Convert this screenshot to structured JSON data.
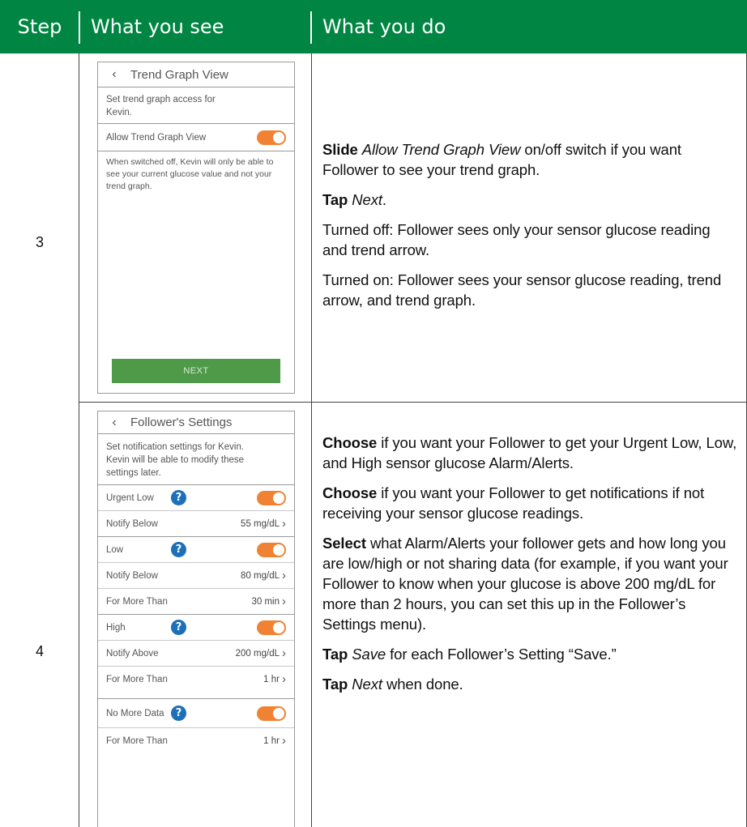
{
  "header": {
    "step": "Step",
    "what_you_see": "What you see",
    "what_you_do": "What you do"
  },
  "rows": [
    {
      "step": "3",
      "screen": {
        "title": "Trend Graph View",
        "description": "Set trend graph access for Kevin.",
        "toggle_label": "Allow Trend Graph View",
        "note": "When switched off, Kevin will only be able to see your current glucose value and not your trend graph.",
        "next": "NEXT"
      },
      "instructions": {
        "p1_verb": "Slide",
        "p1_em": "Allow Trend Graph View",
        "p1_rest": "on/off switch if you want Follower to see your trend graph.",
        "p2_verb": "Tap",
        "p2_em": "Next",
        "p2_rest": ".",
        "p3": "Turned off: Follower sees only your sensor glucose reading and trend arrow.",
        "p4": "Turned on: Follower sees your sensor glucose reading, trend arrow, and trend graph."
      }
    },
    {
      "step": "4",
      "screen": {
        "title": "Follower's Settings",
        "description": "Set notification settings for Kevin. Kevin will be able to modify these settings later.",
        "urgent_low": "Urgent Low",
        "urgent_notify_label": "Notify Below",
        "urgent_notify_value": "55 mg/dL",
        "low": "Low",
        "low_notify_label": "Notify Below",
        "low_notify_value": "80 mg/dL",
        "low_more_label": "For More Than",
        "low_more_value": "30 min",
        "high": "High",
        "high_notify_label": "Notify Above",
        "high_notify_value": "200 mg/dL",
        "high_more_label": "For More Than",
        "high_more_value": "1 hr",
        "nodata": "No More Data",
        "nodata_more_label": "For More Than",
        "nodata_more_value": "1 hr"
      },
      "instructions": {
        "p1_verb": "Choose",
        "p1_rest": "if you want your Follower to get your Urgent Low, Low, and High sensor glucose Alarm/Alerts.",
        "p2_verb": "Choose",
        "p2_rest": "if you want your Follower to get notifications if not receiving your sensor glucose readings.",
        "p3_verb": "Select",
        "p3_rest": "what Alarm/Alerts your follower gets and how long you are low/high or not sharing data (for example, if you want your Follower to know when your glucose is above 200 mg/dL for more than 2 hours, you can set this up in the Follower’s Settings menu).",
        "p4_verb": "Tap",
        "p4_em": "Save",
        "p4_rest": "for each Follower’s Setting “Save.”",
        "p5_verb": "Tap",
        "p5_em": "Next",
        "p5_rest": "when done."
      }
    }
  ],
  "colors": {
    "header_bg": "#008542",
    "toggle_on": "#f08234",
    "help_icon": "#1c6fb8",
    "next_button": "#4e9a49"
  },
  "icons": [
    "back-chevron-icon",
    "toggle-switch-icon",
    "help-icon",
    "chevron-right-icon"
  ]
}
